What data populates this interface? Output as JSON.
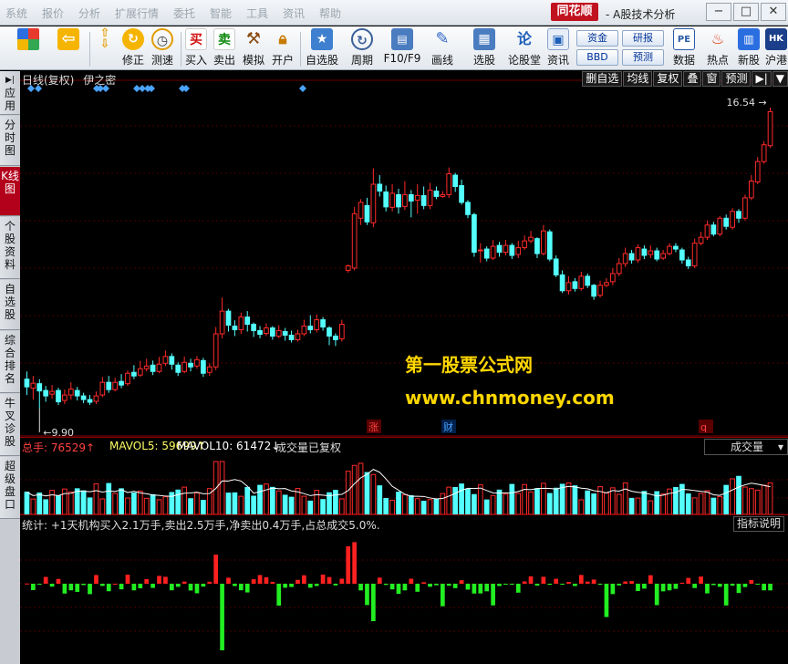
{
  "menu": [
    "系统",
    "报价",
    "分析",
    "扩展行情",
    "委托",
    "智能",
    "工具",
    "资讯",
    "帮助"
  ],
  "app": {
    "logo": "同花顺",
    "title": "- A股技术分析"
  },
  "toolbar": {
    "buttons": [
      {
        "label": "",
        "icon": "grid-color-icon"
      },
      {
        "label": "",
        "icon": "back-arrow-icon"
      },
      {
        "label": "",
        "icon": "up-down-arrows-icon"
      },
      {
        "label": "修正",
        "icon": "refresh-icon"
      },
      {
        "label": "测速",
        "icon": "clock-icon"
      },
      {
        "label": "买入",
        "icon": "buy-icon"
      },
      {
        "label": "卖出",
        "icon": "sell-icon"
      },
      {
        "label": "模拟",
        "icon": "hammer-icon"
      },
      {
        "label": "开户",
        "icon": "lock-icon"
      },
      {
        "label": "自选股",
        "icon": "star-folder-icon"
      },
      {
        "label": "周期",
        "icon": "cycle-icon"
      },
      {
        "label": "F10/F9",
        "icon": "chart-window-icon"
      },
      {
        "label": "画线",
        "icon": "pencil-icon"
      },
      {
        "label": "选股",
        "icon": "select-stock-icon"
      },
      {
        "label": "论股堂",
        "icon": "forum-icon"
      },
      {
        "label": "资讯",
        "icon": "news-icon"
      },
      {
        "label": "数据",
        "icon": "pe-data-icon"
      },
      {
        "label": "热点",
        "icon": "hot-icon"
      },
      {
        "label": "新股",
        "icon": "new-stock-icon"
      },
      {
        "label": "沪港",
        "icon": "hk-icon"
      }
    ],
    "small_buttons": [
      "资金",
      "BBD",
      "研报",
      "预测"
    ]
  },
  "left_tabs": [
    "应用",
    "分时图",
    "K线图",
    "个股资料",
    "自选股",
    "综合排名",
    "牛叉诊股",
    "超级盘口"
  ],
  "chart_header": {
    "title": "日线(复权)",
    "indicator": "伊之密"
  },
  "chart_tabs": [
    "删自选",
    "均线",
    "复权",
    "叠",
    "窗",
    "预测",
    "▶|",
    "▼"
  ],
  "overlay": {
    "line1": "第一股票公式网",
    "line2": "www.chnmoney.com"
  },
  "price_labels": {
    "high": "16.54",
    "low": "9.90"
  },
  "event_markers": [
    {
      "text": "涨",
      "color": "#ff4040"
    },
    {
      "text": "财",
      "color": "#4aa3ff"
    },
    {
      "text": "q",
      "color": "#ff4040"
    }
  ],
  "volume_header": {
    "total": "总手: 76529↑",
    "ma5": "MAVOL5: 59699↑",
    "ma10": "MAVOL10: 61472↓",
    "note": "成交量已复权",
    "select": "成交量",
    "colors": {
      "total": "#ff4040",
      "ma5": "#ffff66",
      "ma10": "#ffffff",
      "note": "#dddddd"
    }
  },
  "stat_header": {
    "text": "统计: +1天机构买入2.1万手,卖出2.5万手,净卖出0.4万手,占总成交5.0%.",
    "button": "指标说明"
  },
  "colors": {
    "up": "#ff2a2a",
    "down": "#54ffff",
    "buy": "#ff2020",
    "sell": "#22ee22",
    "marker": "#4aa3ff"
  },
  "chart_data": {
    "type": "candlestick",
    "price_range": [
      9.9,
      16.54
    ],
    "candles": [
      [
        10.55,
        10.38,
        10.72,
        10.2
      ],
      [
        10.35,
        10.46,
        10.62,
        10.1
      ],
      [
        10.45,
        10.29,
        10.55,
        9.9
      ],
      [
        10.3,
        10.18,
        10.4,
        10.05
      ],
      [
        10.22,
        10.28,
        10.42,
        10.12
      ],
      [
        10.3,
        10.05,
        10.36,
        9.98
      ],
      [
        10.08,
        10.2,
        10.32,
        10.0
      ],
      [
        10.2,
        10.33,
        10.48,
        10.1
      ],
      [
        10.3,
        10.18,
        10.38,
        10.08
      ],
      [
        10.18,
        10.1,
        10.25,
        10.02
      ],
      [
        10.1,
        10.04,
        10.2,
        9.98
      ],
      [
        10.06,
        10.18,
        10.28,
        10.0
      ],
      [
        10.2,
        10.48,
        10.6,
        10.15
      ],
      [
        10.48,
        10.32,
        10.62,
        10.25
      ],
      [
        10.32,
        10.48,
        10.58,
        10.28
      ],
      [
        10.5,
        10.42,
        10.66,
        10.35
      ],
      [
        10.45,
        10.68,
        10.74,
        10.4
      ],
      [
        10.7,
        10.62,
        10.86,
        10.55
      ],
      [
        10.64,
        10.78,
        10.95,
        10.6
      ],
      [
        10.78,
        10.84,
        11.0,
        10.72
      ],
      [
        10.86,
        10.72,
        10.96,
        10.64
      ],
      [
        10.72,
        10.88,
        11.04,
        10.68
      ],
      [
        10.9,
        11.05,
        11.18,
        10.84
      ],
      [
        11.05,
        10.88,
        11.12,
        10.76
      ],
      [
        10.86,
        10.7,
        10.92,
        10.62
      ],
      [
        10.72,
        10.92,
        11.05,
        10.68
      ],
      [
        10.9,
        10.82,
        11.0,
        10.72
      ],
      [
        10.84,
        10.98,
        11.06,
        10.78
      ],
      [
        10.96,
        10.68,
        11.02,
        10.6
      ],
      [
        10.7,
        10.82,
        10.9,
        10.62
      ],
      [
        10.82,
        11.55,
        11.7,
        10.75
      ],
      [
        11.55,
        12.05,
        12.35,
        11.45
      ],
      [
        12.05,
        11.74,
        12.1,
        11.6
      ],
      [
        11.72,
        11.64,
        11.85,
        11.5
      ],
      [
        11.64,
        11.92,
        12.02,
        11.55
      ],
      [
        11.92,
        11.76,
        12.05,
        11.6
      ],
      [
        11.76,
        11.62,
        11.8,
        11.48
      ],
      [
        11.62,
        11.54,
        11.72,
        11.45
      ],
      [
        11.56,
        11.68,
        11.78,
        11.5
      ],
      [
        11.68,
        11.5,
        11.72,
        11.42
      ],
      [
        11.5,
        11.62,
        11.74,
        11.45
      ],
      [
        11.6,
        11.52,
        11.68,
        11.4
      ],
      [
        11.52,
        11.42,
        11.62,
        11.36
      ],
      [
        11.42,
        11.55,
        11.64,
        11.38
      ],
      [
        11.55,
        11.72,
        11.86,
        11.5
      ],
      [
        11.72,
        11.64,
        11.96,
        11.56
      ],
      [
        11.64,
        11.86,
        11.98,
        11.58
      ],
      [
        11.86,
        11.7,
        11.92,
        11.62
      ],
      [
        11.68,
        11.5,
        11.72,
        11.3
      ],
      [
        11.5,
        11.42,
        11.56,
        11.28
      ],
      [
        11.44,
        11.76,
        11.86,
        11.38
      ],
      [
        12.95,
        13.05,
        13.08,
        12.9
      ],
      [
        13.0,
        14.2,
        14.35,
        12.95
      ],
      [
        14.1,
        14.45,
        14.52,
        13.95
      ],
      [
        14.38,
        14.02,
        14.55,
        13.95
      ],
      [
        14.0,
        14.85,
        15.2,
        13.9
      ],
      [
        14.85,
        14.7,
        15.05,
        14.58
      ],
      [
        14.68,
        14.35,
        14.82,
        14.25
      ],
      [
        14.34,
        14.65,
        14.85,
        14.25
      ],
      [
        14.62,
        14.35,
        14.75,
        14.2
      ],
      [
        14.36,
        14.62,
        14.92,
        14.28
      ],
      [
        14.62,
        14.48,
        14.72,
        14.12
      ],
      [
        14.5,
        14.6,
        14.85,
        14.2
      ],
      [
        14.6,
        14.38,
        14.8,
        14.3
      ],
      [
        14.38,
        14.72,
        14.88,
        14.3
      ],
      [
        14.7,
        14.58,
        14.8,
        14.52
      ],
      [
        14.58,
        14.62,
        14.7,
        14.55
      ],
      [
        14.62,
        15.08,
        15.22,
        14.55
      ],
      [
        15.05,
        14.8,
        15.1,
        14.68
      ],
      [
        14.82,
        14.45,
        14.95,
        14.4
      ],
      [
        14.45,
        14.18,
        14.5,
        14.1
      ],
      [
        14.18,
        13.35,
        14.22,
        13.25
      ],
      [
        13.38,
        13.4,
        13.55,
        13.12
      ],
      [
        13.42,
        13.22,
        13.48,
        13.15
      ],
      [
        13.22,
        13.48,
        13.62,
        13.18
      ],
      [
        13.5,
        13.35,
        13.58,
        13.25
      ],
      [
        13.35,
        13.5,
        13.62,
        13.28
      ],
      [
        13.5,
        13.28,
        13.55,
        13.2
      ],
      [
        13.3,
        13.45,
        13.6,
        13.22
      ],
      [
        13.45,
        13.6,
        13.72,
        13.4
      ],
      [
        13.6,
        13.68,
        13.82,
        13.55
      ],
      [
        13.65,
        13.32,
        13.68,
        13.22
      ],
      [
        13.32,
        13.82,
        13.95,
        13.28
      ],
      [
        13.8,
        13.2,
        13.85,
        13.15
      ],
      [
        13.2,
        12.85,
        13.28,
        12.8
      ],
      [
        12.85,
        12.5,
        12.95,
        12.45
      ],
      [
        12.5,
        12.68,
        12.82,
        12.42
      ],
      [
        12.7,
        12.55,
        12.78,
        12.48
      ],
      [
        12.55,
        12.82,
        12.92,
        12.5
      ],
      [
        12.82,
        12.62,
        12.88,
        12.56
      ],
      [
        12.62,
        12.38,
        12.65,
        12.3
      ],
      [
        12.4,
        12.62,
        12.72,
        12.35
      ],
      [
        12.62,
        12.68,
        12.78,
        12.58
      ],
      [
        12.7,
        12.88,
        13.0,
        12.62
      ],
      [
        12.88,
        13.1,
        13.22,
        12.82
      ],
      [
        13.1,
        13.32,
        13.45,
        13.02
      ],
      [
        13.32,
        13.18,
        13.4,
        13.1
      ],
      [
        13.18,
        13.45,
        13.52,
        13.12
      ],
      [
        13.42,
        13.28,
        13.5,
        13.2
      ],
      [
        13.3,
        13.38,
        13.5,
        13.22
      ],
      [
        13.38,
        13.2,
        13.45,
        13.15
      ],
      [
        13.22,
        13.32,
        13.4,
        13.18
      ],
      [
        13.32,
        13.48,
        13.55,
        13.28
      ],
      [
        13.48,
        13.42,
        13.55,
        13.35
      ],
      [
        13.4,
        13.18,
        13.45,
        13.1
      ],
      [
        13.18,
        13.05,
        13.25,
        12.98
      ],
      [
        13.05,
        13.55,
        13.65,
        13.0
      ],
      [
        13.55,
        13.68,
        13.8,
        13.5
      ],
      [
        13.68,
        13.95,
        14.05,
        13.62
      ],
      [
        13.95,
        13.75,
        14.02,
        13.7
      ],
      [
        13.75,
        14.1,
        14.15,
        13.7
      ],
      [
        14.1,
        13.92,
        14.18,
        13.85
      ],
      [
        13.9,
        14.25,
        14.32,
        13.85
      ],
      [
        14.25,
        14.1,
        14.3,
        14.0
      ],
      [
        14.1,
        14.55,
        14.62,
        14.05
      ],
      [
        14.55,
        14.92,
        15.05,
        14.5
      ],
      [
        14.9,
        15.35,
        15.45,
        14.85
      ],
      [
        15.35,
        15.72,
        15.8,
        15.3
      ],
      [
        15.7,
        16.45,
        16.54,
        15.65
      ]
    ],
    "volume_ma5": 59699,
    "volume_ma10": 61472
  }
}
